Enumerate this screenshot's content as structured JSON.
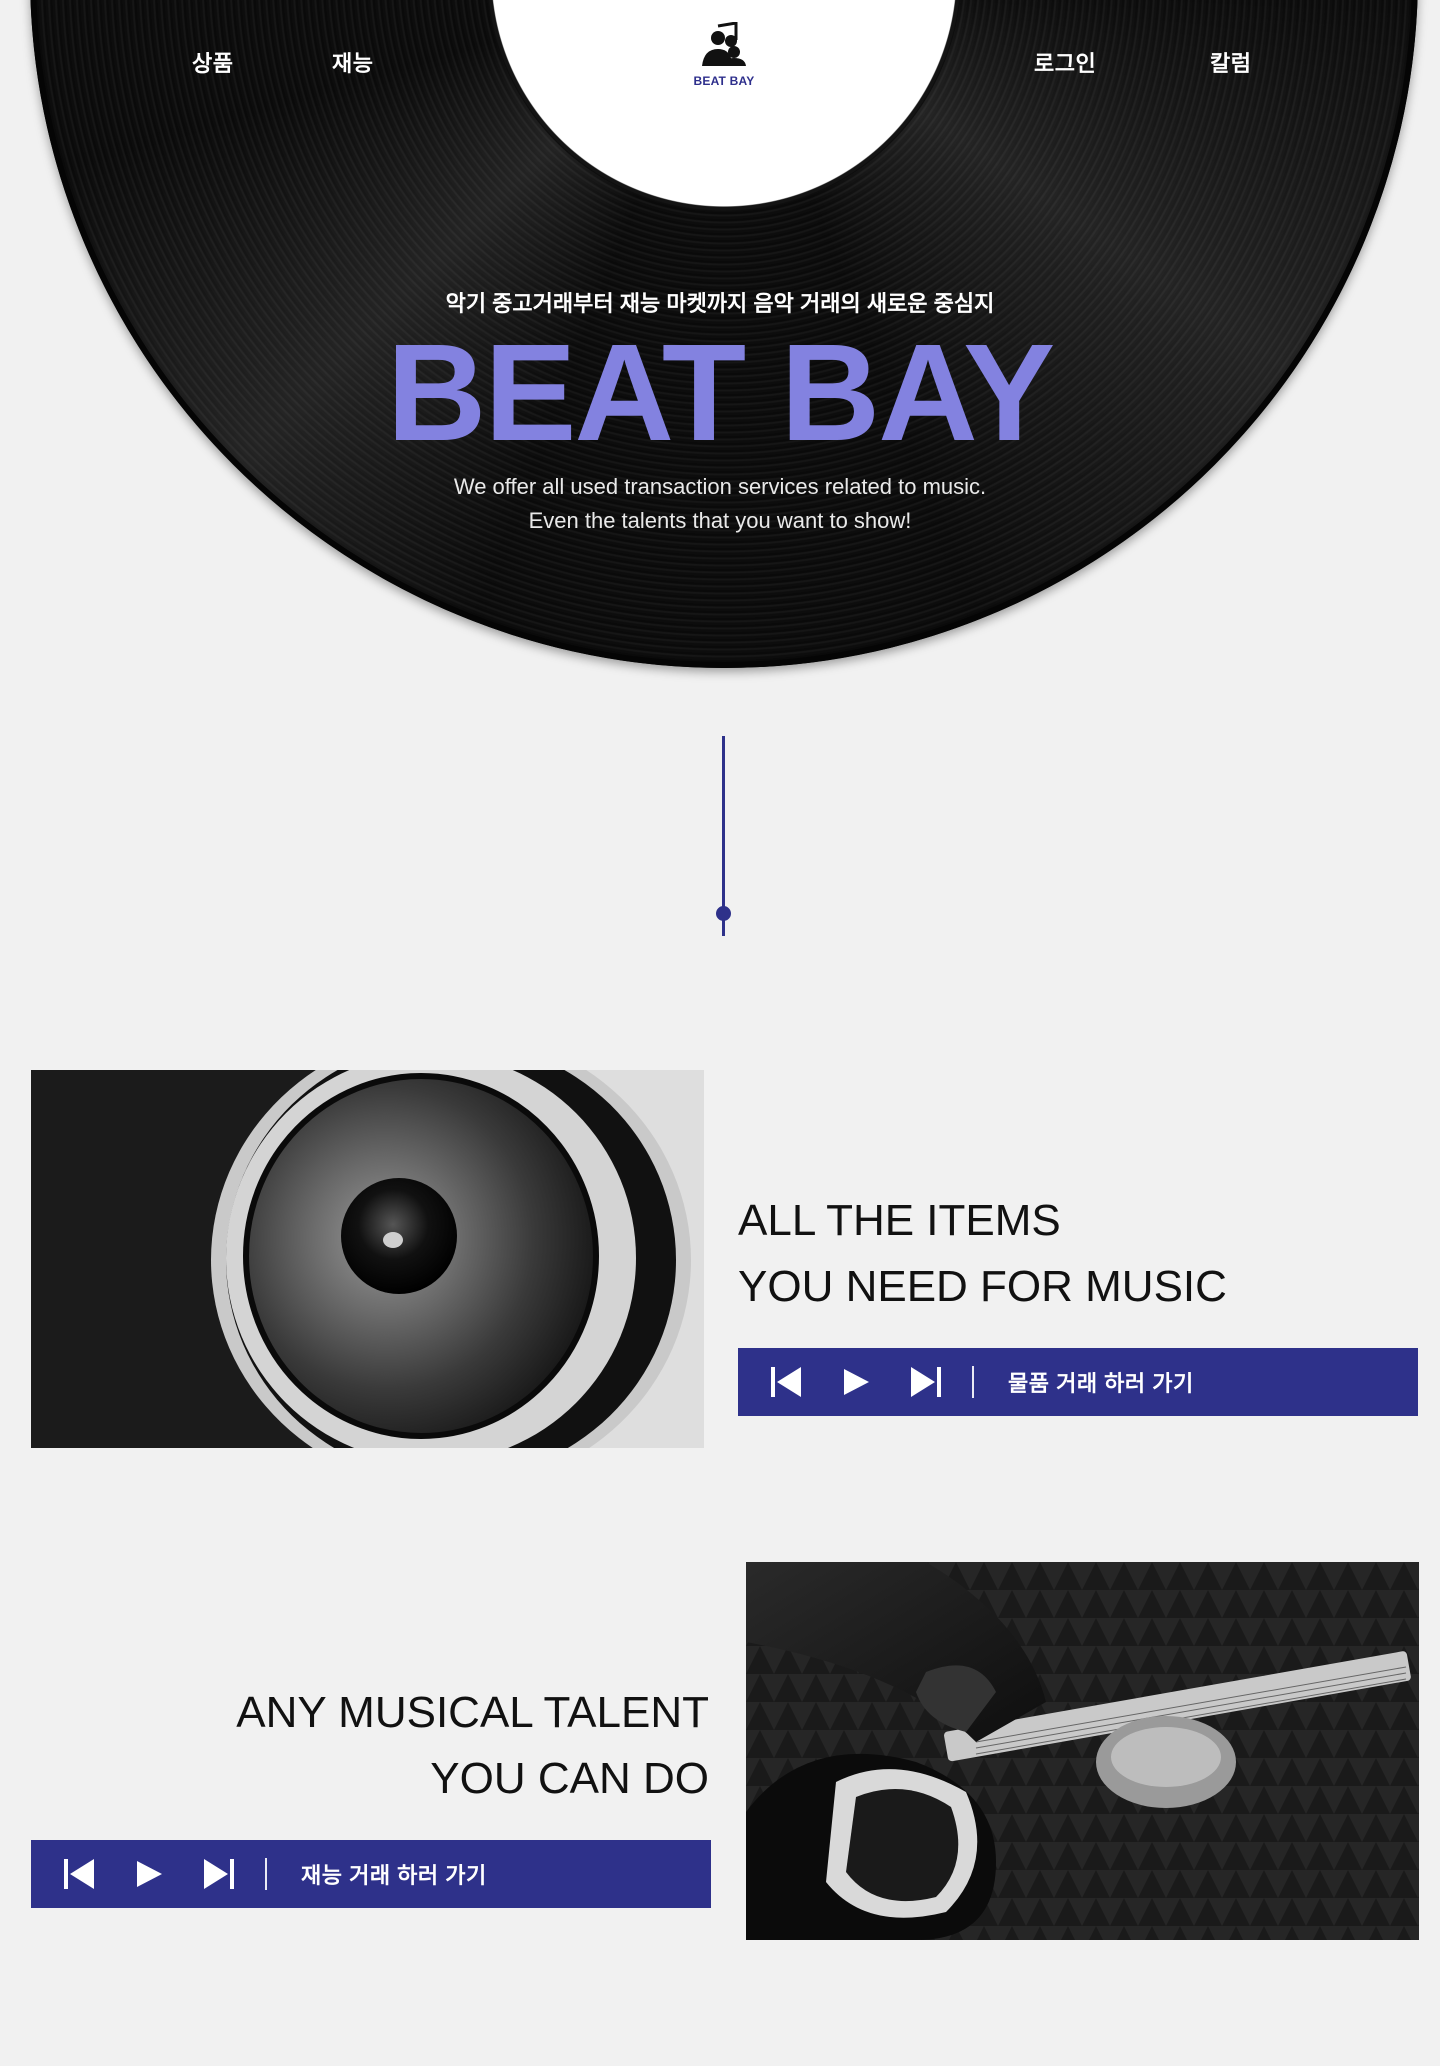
{
  "nav": {
    "products": "상품",
    "talent": "재능",
    "login": "로그인",
    "column": "칼럼"
  },
  "logo": {
    "icon": "music-people-icon",
    "text": "BEAT BAY"
  },
  "hero": {
    "subtitle": "악기 중고거래부터 재능 마켓까지 음악 거래의 새로운 중심지",
    "title": "BEAT BAY",
    "desc_line1": "We offer all used transaction services related to music.",
    "desc_line2": "Even the talents that you want to show!"
  },
  "items_section": {
    "title_line1": "ALL THE ITEMS",
    "title_line2": "YOU NEED FOR MUSIC",
    "cta_label": "물품 거래 하러 가기",
    "image": "speaker-photo"
  },
  "talent_section": {
    "title_line1": "ANY MUSICAL TALENT",
    "title_line2": "YOU CAN DO",
    "cta_label": "재능 거래 하러 가기",
    "image": "guitar-photo"
  },
  "colors": {
    "accent": "#2e318a",
    "hero_title": "#8382e0",
    "background": "#f1f1f1"
  }
}
